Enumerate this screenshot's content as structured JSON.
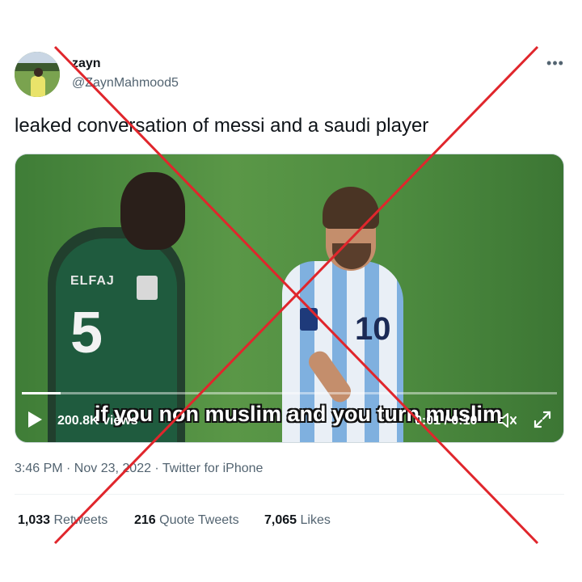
{
  "author": {
    "display_name": "zayn",
    "handle": "@ZaynMahmood5"
  },
  "tweet": {
    "text": "leaked conversation of messi and a saudi player",
    "meta": "3:46 PM · Nov 23, 2022 · Twitter for iPhone"
  },
  "video": {
    "caption": "if you non muslim and you turn muslim",
    "views": "200.8K views",
    "time": "0:01 / 0:10",
    "progress_fraction": 0.01,
    "player1_number": "5",
    "player1_name": "ELFAJ",
    "player2_number": "10"
  },
  "stats": {
    "retweets_count": "1,033",
    "retweets_label": "Retweets",
    "quote_count": "216",
    "quote_label": "Quote Tweets",
    "likes_count": "7,065",
    "likes_label": "Likes"
  },
  "icons": {
    "more": "more-icon",
    "play": "play-icon",
    "volume": "volume-icon",
    "expand": "expand-icon"
  },
  "colors": {
    "cross": "#e0262c",
    "secondary_text": "#536471"
  }
}
